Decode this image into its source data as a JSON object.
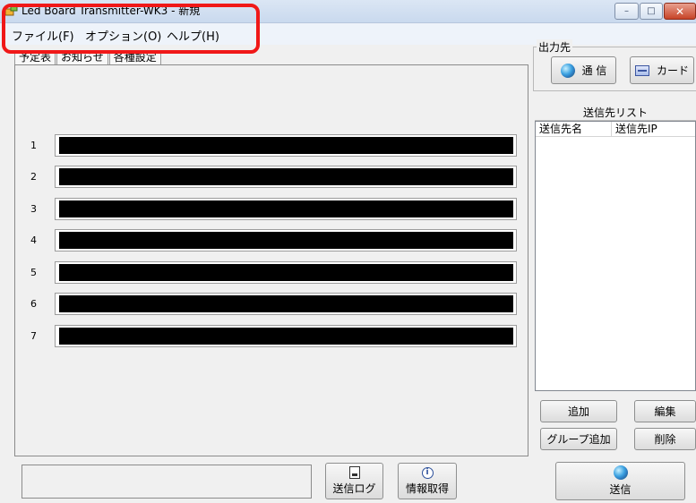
{
  "window": {
    "title": "Led Board Transmitter-WK3 - 新規",
    "min_glyph": "–",
    "max_glyph": "□",
    "close_glyph": "✕"
  },
  "menu": [
    {
      "label": "ファイル(F)"
    },
    {
      "label": "オプション(O)"
    },
    {
      "label": "ヘルプ(H)"
    }
  ],
  "tabs": [
    {
      "label": "予定表"
    },
    {
      "label": "お知らせ"
    },
    {
      "label": "各種設定"
    }
  ],
  "rows": [
    {
      "num": "1"
    },
    {
      "num": "2"
    },
    {
      "num": "3"
    },
    {
      "num": "4"
    },
    {
      "num": "5"
    },
    {
      "num": "6"
    },
    {
      "num": "7"
    }
  ],
  "output": {
    "legend": "出力先",
    "comm_label": "通 信",
    "card_label": "カード"
  },
  "send_list": {
    "title": "送信先リスト",
    "columns": [
      "送信先名",
      "送信先IP"
    ]
  },
  "list_buttons": {
    "add": "追加",
    "edit": "編集",
    "group_add": "グループ追加",
    "delete": "削除"
  },
  "bottom": {
    "send_log": "送信ログ",
    "info_get": "情報取得",
    "send": "送信"
  },
  "icons": {
    "app": "app-icon",
    "comm": "globe-icon",
    "card": "card-icon",
    "log": "log-icon",
    "info": "info-icon",
    "send": "globe-icon"
  },
  "colors": {
    "highlight": "#f01818",
    "display_line": "#000000"
  }
}
